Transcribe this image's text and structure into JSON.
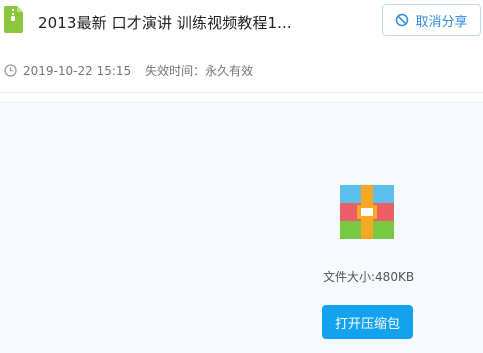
{
  "file": {
    "title": "2013最新 口才演讲 训练视频教程1...",
    "date": "2019-10-22 15:15",
    "expire": "失效时间：永久有效",
    "size_label": "文件大小:480KB",
    "type_icon": "zip-file-icon"
  },
  "actions": {
    "cancel_share": "取消分享",
    "open_zip": "打开压缩包"
  },
  "colors": {
    "accent": "#13a2ee",
    "link": "#2f8bde",
    "file_icon_green": "#8cc63f",
    "zip_blue": "#5bc0eb",
    "zip_red": "#ec5f67",
    "zip_green": "#7ac943",
    "zip_orange": "#f7a823"
  },
  "icons": [
    "zip-file-icon",
    "ban-icon",
    "clock-icon",
    "archive-icon"
  ]
}
